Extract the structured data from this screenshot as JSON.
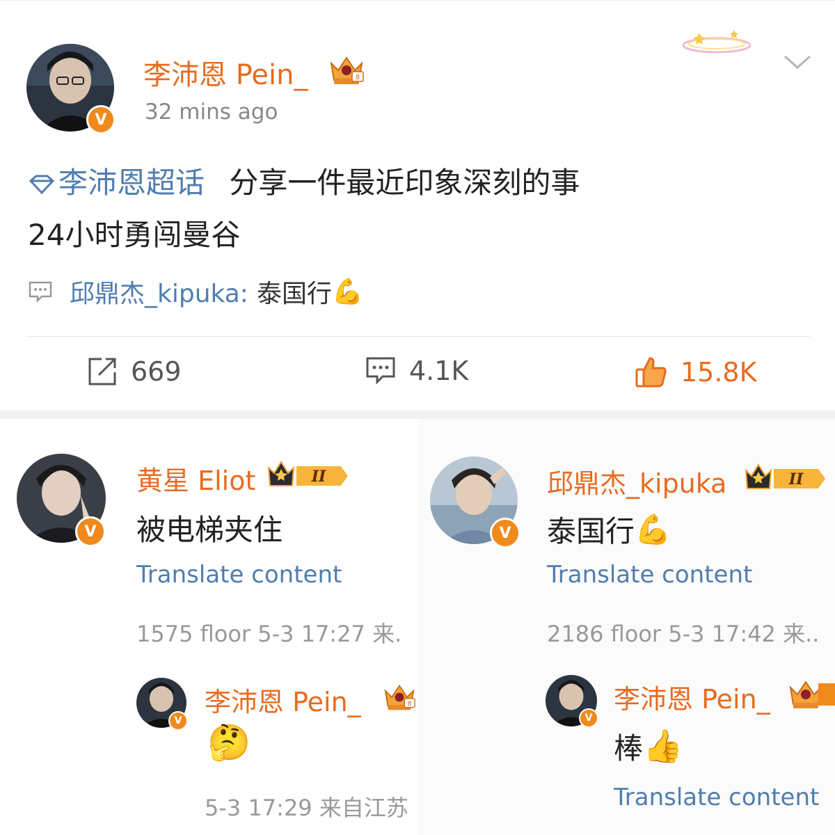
{
  "post": {
    "author": "李沛恩 Pein_",
    "time": "32 mins ago",
    "topic": "李沛恩超话",
    "text_line1": "分享一件最近印象深刻的事",
    "text_line2": "24小时勇闯曼谷",
    "repost_user": "邱鼎杰_kipuka:",
    "repost_text": "泰国行",
    "repost_emoji": "💪",
    "shares": "669",
    "comments": "4.1K",
    "likes": "15.8K"
  },
  "comments": [
    {
      "author": "黄星 Eliot",
      "level": "II",
      "text": "被电梯夹住",
      "translate": "Translate content",
      "meta": "1575 floor 5-3 17:27 来.",
      "reply": {
        "author": "李沛恩 Pein_",
        "emoji": "🤔",
        "meta": "5-3 17:29 来自江苏"
      }
    },
    {
      "author": "邱鼎杰_kipuka",
      "level": "II",
      "text": "泰国行",
      "emoji": "💪",
      "translate": "Translate content",
      "meta": "2186 floor 5-3 17:42 来..",
      "reply": {
        "author": "李沛恩 Pein_",
        "text": "棒",
        "emoji": "👍",
        "translate": "Translate content"
      }
    }
  ],
  "colors": {
    "orange": "#e86b1f",
    "link_blue": "#507daf",
    "gray": "#888888"
  }
}
